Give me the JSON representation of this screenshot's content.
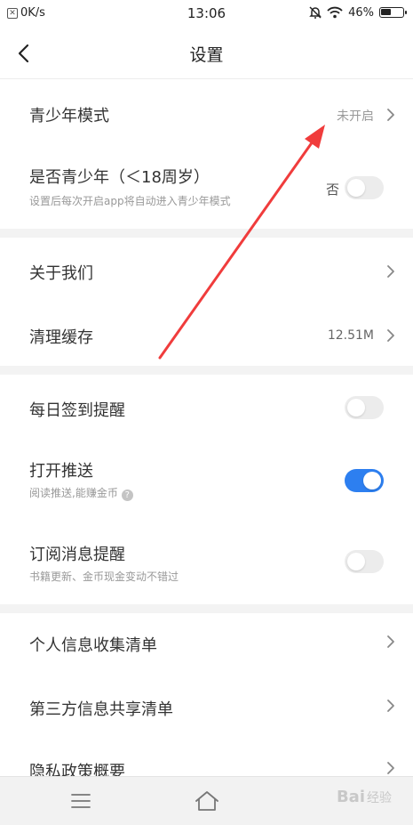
{
  "status_bar": {
    "net_speed": "0K/s",
    "time": "13:06",
    "battery": "46%",
    "battery_level": 0.46
  },
  "header": {
    "title": "设置"
  },
  "section1": {
    "teen_mode": {
      "label": "青少年模式",
      "value": "未开启"
    },
    "is_teen": {
      "label": "是否青少年（＜18周岁）",
      "sub": "设置后每次开启app将自动进入青少年模式",
      "toggle_label": "否",
      "enabled": false
    }
  },
  "section2": {
    "about": {
      "label": "关于我们"
    },
    "clear_cache": {
      "label": "清理缓存",
      "value": "12.51M"
    }
  },
  "section3": {
    "checkin_reminder": {
      "label": "每日签到提醒",
      "enabled": false
    },
    "push": {
      "label": "打开推送",
      "sub": "阅读推送,能赚金币",
      "help": "?",
      "enabled": true
    },
    "subscription": {
      "label": "订阅消息提醒",
      "sub": "书籍更新、金币现金变动不错过",
      "enabled": false
    }
  },
  "section4": {
    "personal_info": {
      "label": "个人信息收集清单"
    },
    "third_party": {
      "label": "第三方信息共享清单"
    },
    "privacy": {
      "label": "隐私政策概要"
    }
  },
  "watermark": {
    "text": "Bai",
    "suffix": "经验"
  },
  "colors": {
    "accent": "#2d7ff0",
    "annotation_arrow": "#f03c3c",
    "divider": "#f3f3f3"
  }
}
